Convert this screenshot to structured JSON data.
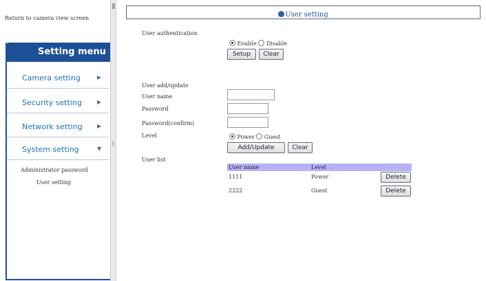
{
  "sidebar": {
    "return_link": "Return to camera view screen",
    "menu_title": "Setting menu",
    "items": [
      {
        "label": "Camera setting",
        "arrow": "▶"
      },
      {
        "label": "Security setting",
        "arrow": "▶"
      },
      {
        "label": "Network setting",
        "arrow": "▶"
      },
      {
        "label": "System setting",
        "arrow": "▼"
      }
    ],
    "submenu": [
      "Administrator password",
      "User setting"
    ]
  },
  "page": {
    "title": "User setting",
    "title_icon": "globe-icon"
  },
  "auth": {
    "label": "User authentication",
    "options": [
      "Enable",
      "Disable"
    ],
    "selected": "Enable",
    "setup_label": "Setup",
    "clear_label": "Clear"
  },
  "add_update": {
    "section_label": "User add/update",
    "username_label": "User name",
    "password_label": "Password",
    "confirm_label": "Password(confirm)",
    "level_label": "Level",
    "level_options": [
      "Power",
      "Guest"
    ],
    "level_selected": "Power",
    "add_update_label": "Add/Update",
    "clear_label": "Clear",
    "username_value": "",
    "password_value": "",
    "confirm_value": ""
  },
  "user_list": {
    "label": "User list",
    "columns": [
      "User name",
      "Level"
    ],
    "rows": [
      {
        "name": "1111",
        "level": "Power",
        "action": "Delete"
      },
      {
        "name": "2222",
        "level": "Guest",
        "action": "Delete"
      }
    ]
  },
  "colors": {
    "menu_blue": "#1d4f97",
    "link_blue": "#1d6fb8",
    "table_header": "#b6b2f7"
  }
}
